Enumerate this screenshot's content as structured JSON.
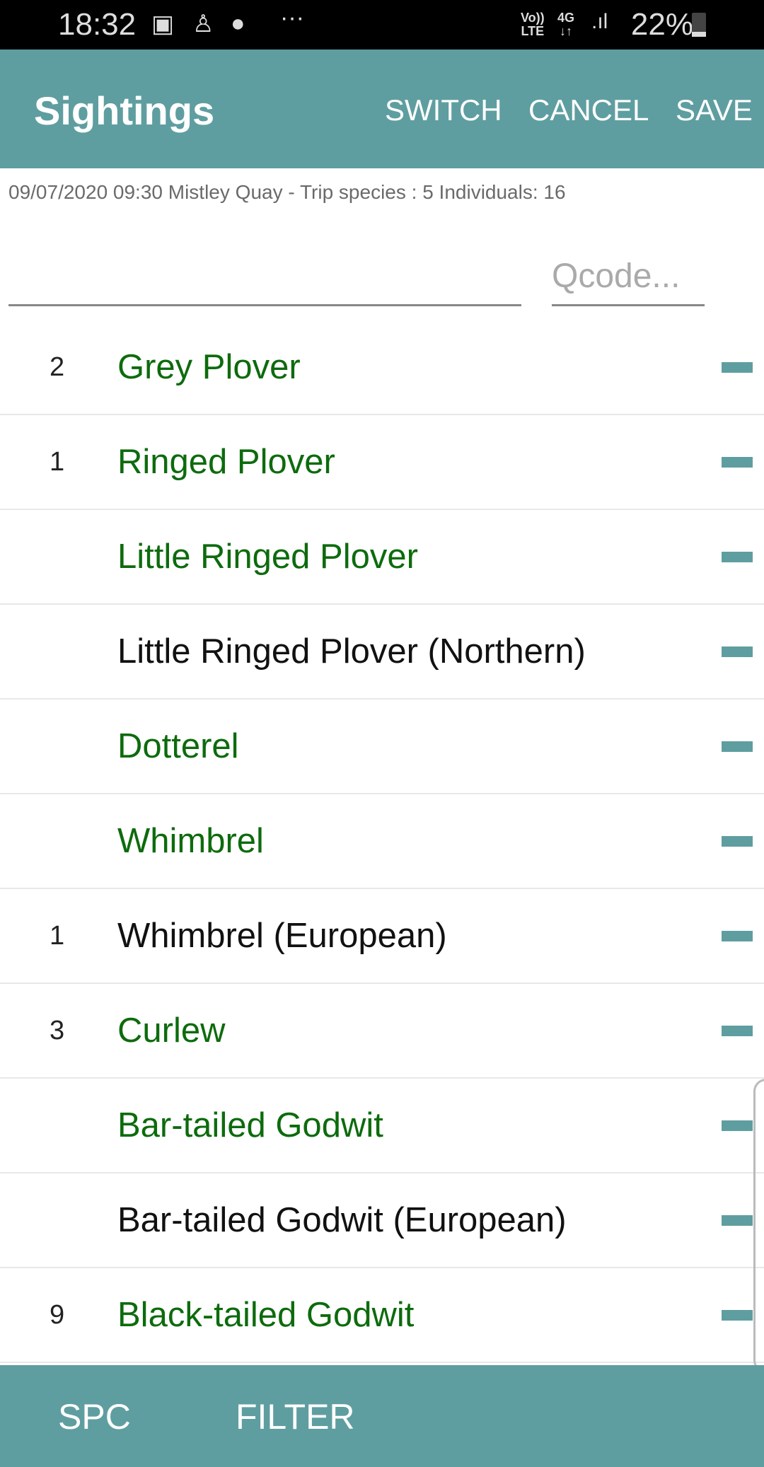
{
  "status_bar": {
    "time": "18:32",
    "icons": [
      "image-icon",
      "notification-icon",
      "bird-app-icon",
      "more-dots-icon"
    ],
    "network_top": "Vo))",
    "network_bottom": "LTE",
    "gen": "4G",
    "battery": "22%",
    "battery_level": 22
  },
  "app_bar": {
    "title": "Sightings",
    "actions": [
      "SWITCH",
      "CANCEL",
      "SAVE"
    ]
  },
  "trip_summary": "09/07/2020 09:30 Mistley Quay - Trip species : 5 Individuals: 16",
  "search": {
    "value": "",
    "placeholder": ""
  },
  "qcode": {
    "value": "",
    "placeholder": "Qcode..."
  },
  "colors": {
    "accent": "#5f9ea0",
    "species_green": "#0d6b0d",
    "subspecies_black": "#111111"
  },
  "species": [
    {
      "count": "2",
      "name": "Grey Plover",
      "type": "species"
    },
    {
      "count": "1",
      "name": "Ringed Plover",
      "type": "species"
    },
    {
      "count": "",
      "name": "Little Ringed Plover",
      "type": "species"
    },
    {
      "count": "",
      "name": "Little Ringed Plover (Northern)",
      "type": "subspecies"
    },
    {
      "count": "",
      "name": "Dotterel",
      "type": "species"
    },
    {
      "count": "",
      "name": "Whimbrel",
      "type": "species"
    },
    {
      "count": "1",
      "name": "Whimbrel (European)",
      "type": "subspecies"
    },
    {
      "count": "3",
      "name": "Curlew",
      "type": "species"
    },
    {
      "count": "",
      "name": "Bar-tailed Godwit",
      "type": "species"
    },
    {
      "count": "",
      "name": "Bar-tailed Godwit (European)",
      "type": "subspecies"
    },
    {
      "count": "9",
      "name": "Black-tailed Godwit",
      "type": "species"
    }
  ],
  "bottom_bar": {
    "spc": "SPC",
    "filter": "FILTER"
  }
}
